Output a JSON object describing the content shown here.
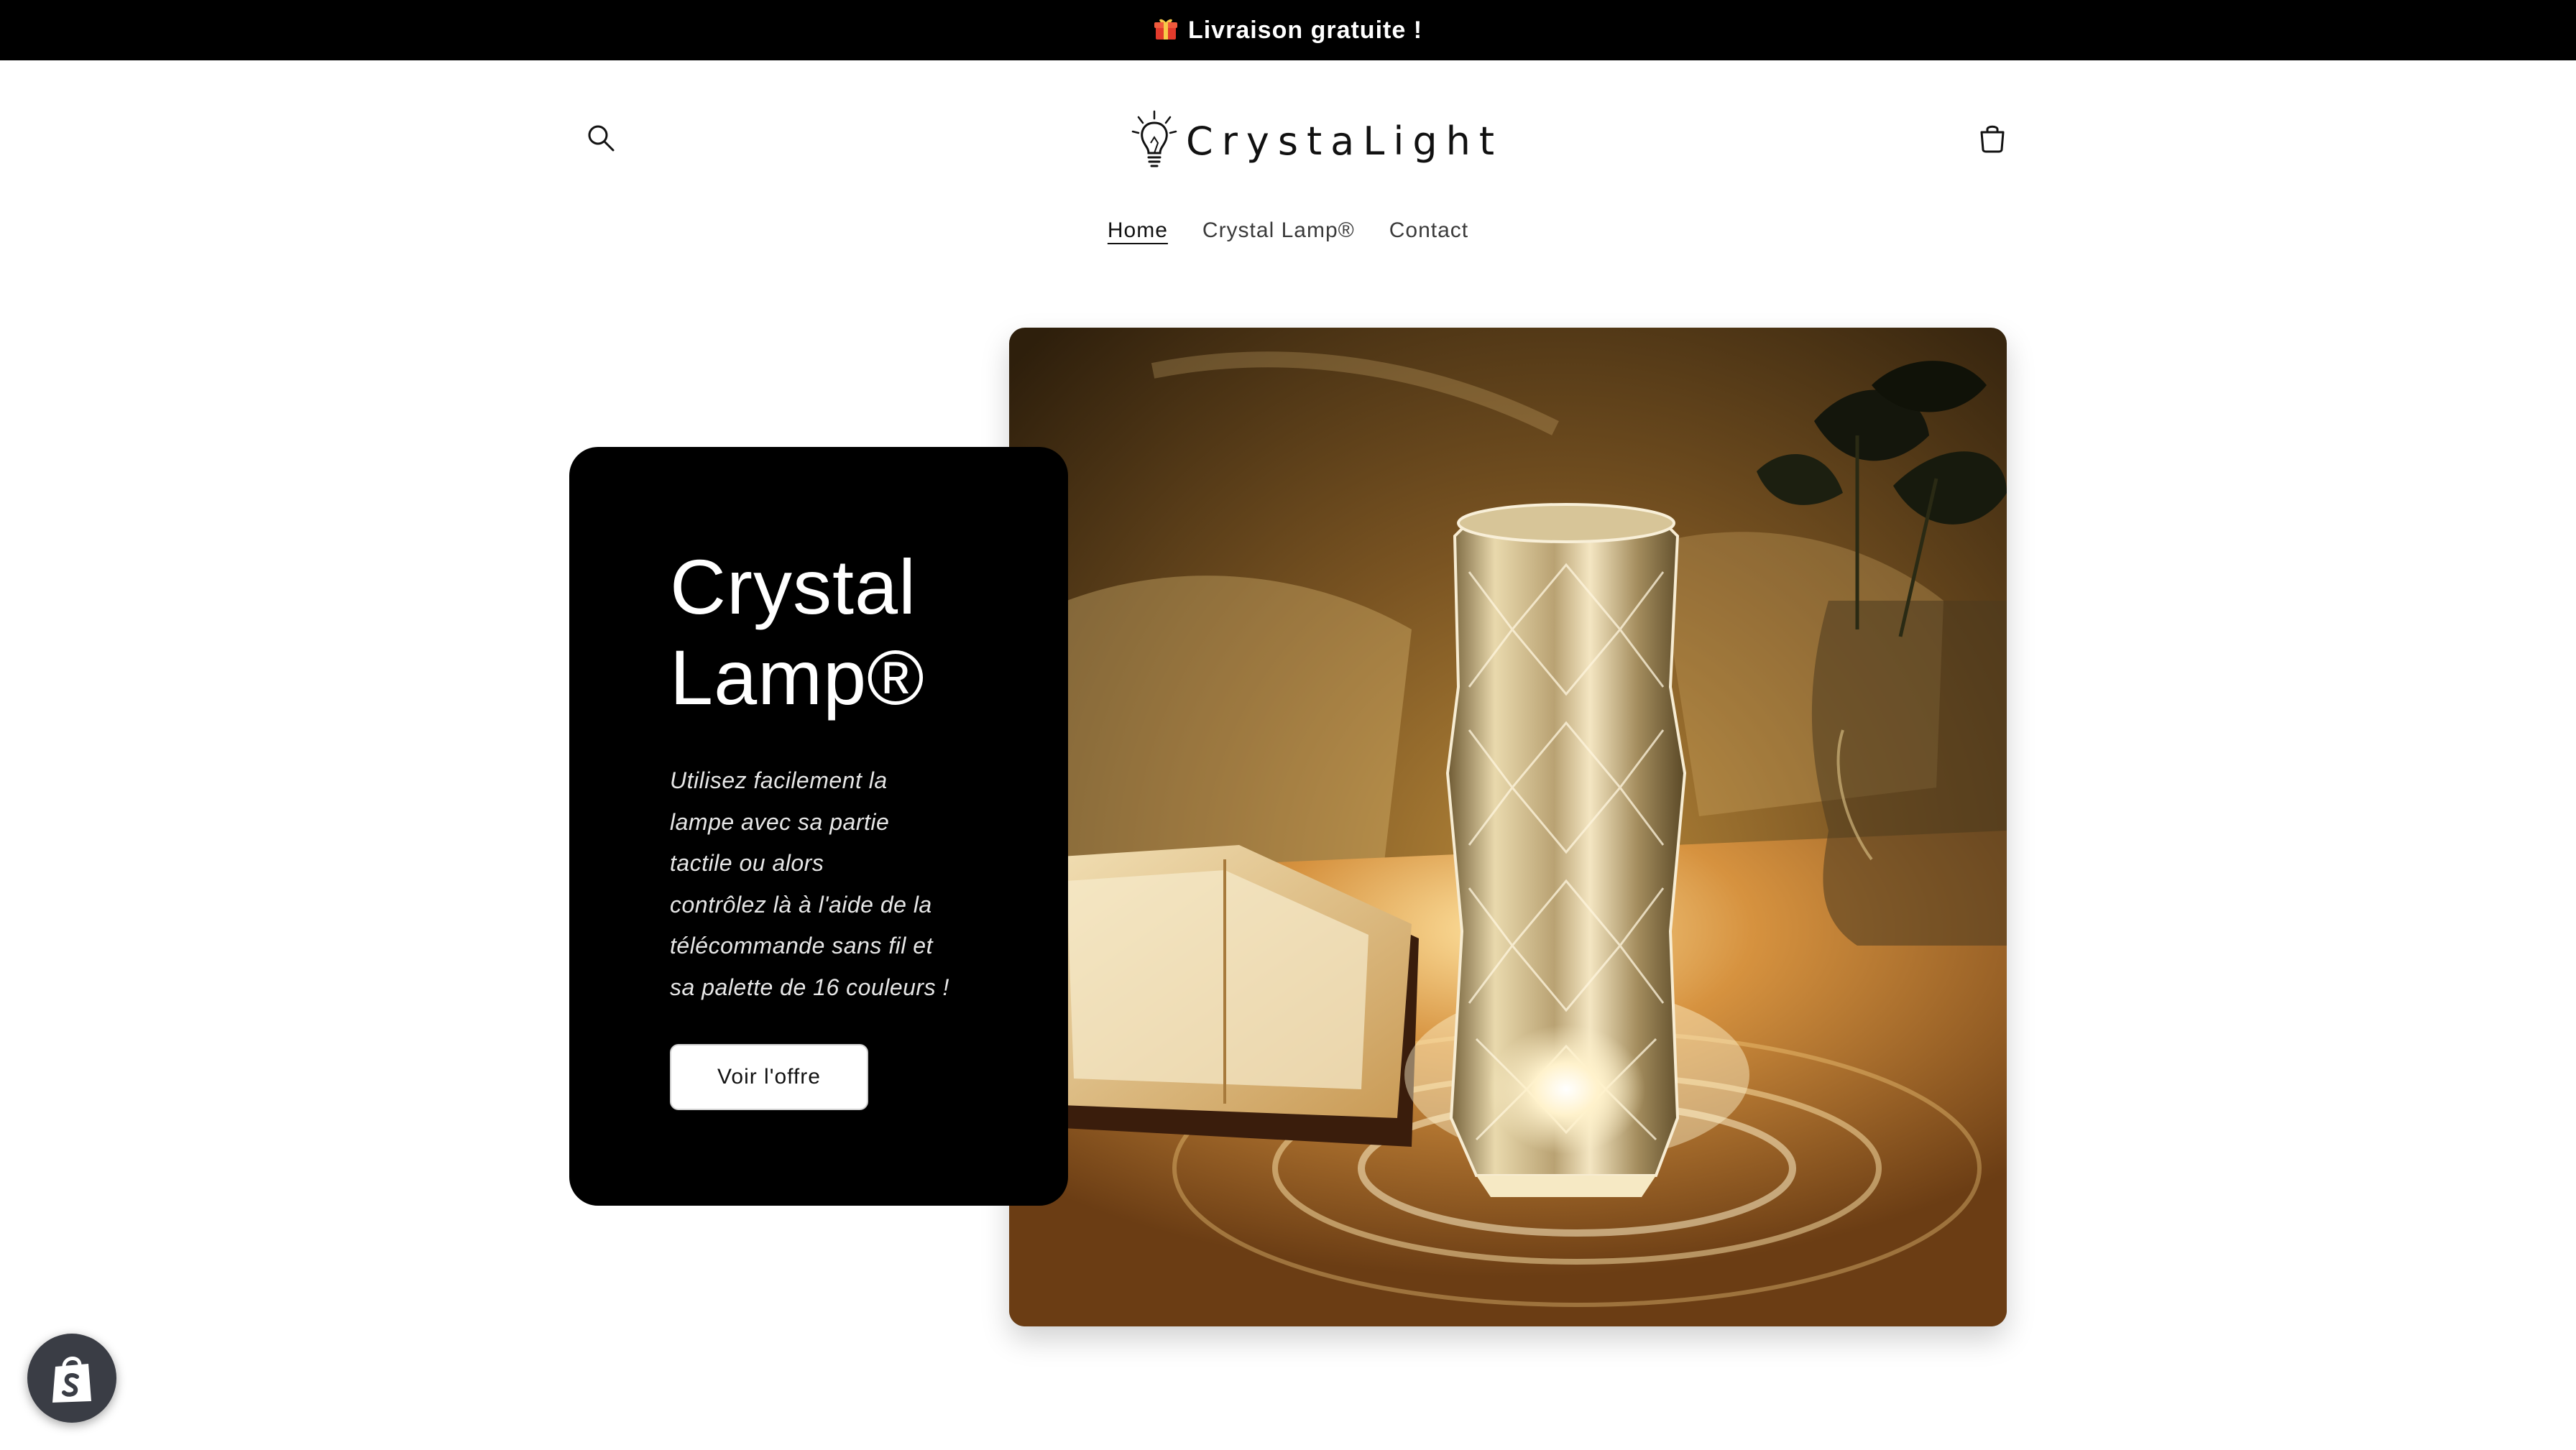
{
  "announcement": {
    "text": "Livraison gratuite !",
    "icon": "gift-icon"
  },
  "header": {
    "brand": "CrystaLight",
    "search_icon": "search-icon",
    "cart_icon": "cart-icon"
  },
  "nav": {
    "items": [
      {
        "label": "Home",
        "active": true
      },
      {
        "label": "Crystal Lamp®",
        "active": false
      },
      {
        "label": "Contact",
        "active": false
      }
    ]
  },
  "hero": {
    "title_line1": "Crystal",
    "title_line2": "Lamp®",
    "text_lines": [
      "Utilisez facilement la",
      "lampe avec sa partie",
      "tactile ou alors",
      "contrôlez là à l'aide de la",
      "télécommande sans fil et",
      "sa palette de 16 couleurs !"
    ],
    "button_label": "Voir l'offre"
  },
  "shopify_badge": {
    "icon": "shopify-bag-icon"
  },
  "colors": {
    "announcement_bg": "#000000",
    "card_bg": "#000000",
    "text": "#121212"
  }
}
